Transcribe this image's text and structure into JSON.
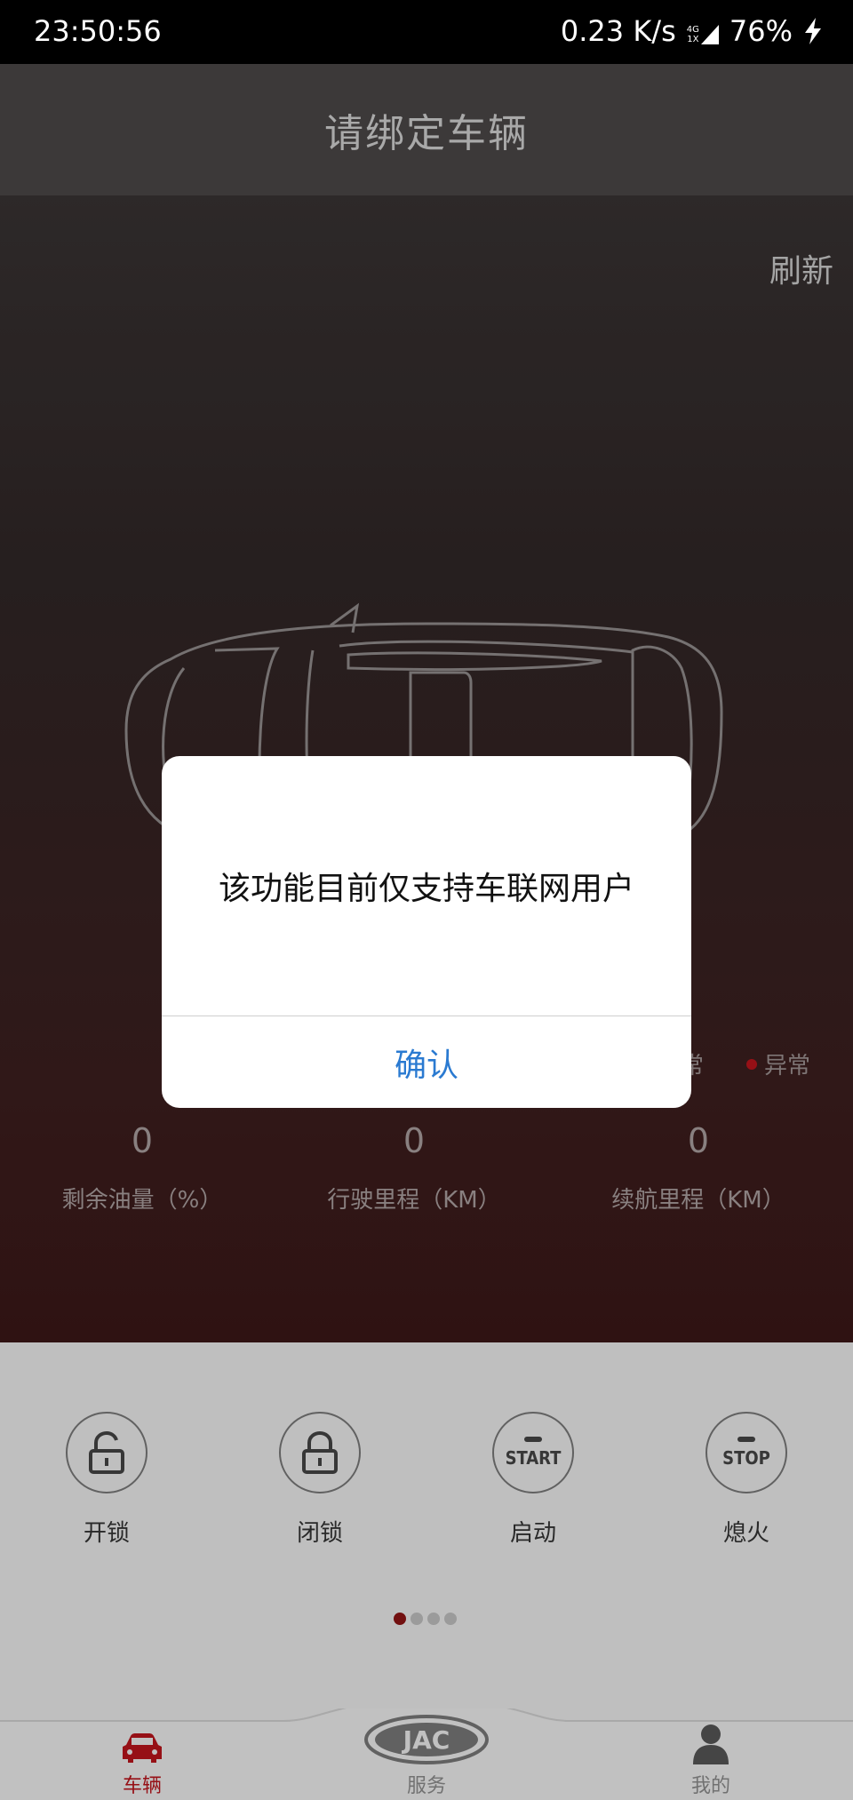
{
  "status_bar": {
    "time": "23:50:56",
    "speed": "0.23 K/s",
    "network_top": "4G",
    "network_bottom": "1X",
    "battery": "76%"
  },
  "header": {
    "title": "请绑定车辆"
  },
  "refresh_label": "刷新",
  "legend": {
    "normal": "正常",
    "abnormal": "异常"
  },
  "stats": [
    {
      "value": "0",
      "label": "剩余油量（%）"
    },
    {
      "value": "0",
      "label": "行驶里程（KM）"
    },
    {
      "value": "0",
      "label": "续航里程（KM）"
    }
  ],
  "controls": [
    {
      "label": "开锁"
    },
    {
      "label": "闭锁"
    },
    {
      "label": "启动",
      "icon_text": "START"
    },
    {
      "label": "熄火",
      "icon_text": "STOP"
    }
  ],
  "pager": {
    "total": 4,
    "active": 1
  },
  "tabs": [
    {
      "label": "车辆",
      "active": true
    },
    {
      "label": "服务",
      "logo": "JAC"
    },
    {
      "label": "我的"
    }
  ],
  "dialog": {
    "message": "该功能目前仅支持车联网用户",
    "confirm": "确认"
  },
  "colors": {
    "accent_red": "#b8141b",
    "link_blue": "#2a7ad1"
  }
}
